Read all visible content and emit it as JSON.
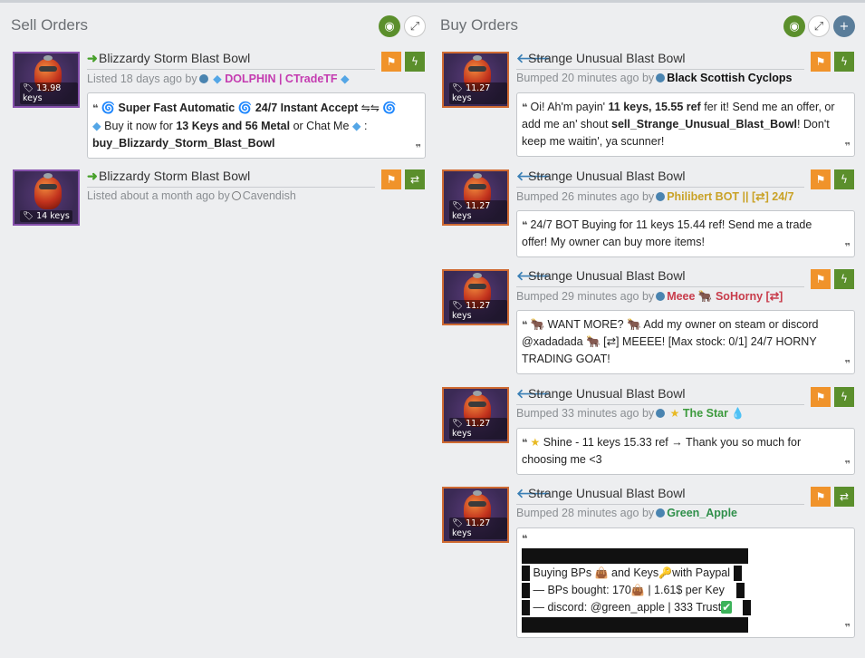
{
  "sell": {
    "title": "Sell Orders",
    "listings": [
      {
        "item": "Blizzardy Storm Blast Bowl",
        "price": "13.98 keys",
        "age": "Listed 18 days ago by",
        "user": "DOLPHIN | CTradeTF",
        "user_color": "#c43bb0",
        "action": "bolt",
        "message": {
          "p1": "Super Fast Automatic",
          "p2": "24/7 Instant Accept",
          "p3": "Buy it now for",
          "p4": "13 Keys and 56 Metal",
          "p5": "or Chat Me",
          "p6": ":",
          "p7": "buy_Blizzardy_Storm_Blast_Bowl"
        }
      },
      {
        "item": "Blizzardy Storm Blast Bowl",
        "price": "14 keys",
        "age": "Listed about a month ago by",
        "user": "Cavendish",
        "user_color": "#8a8e92",
        "action": "trade"
      }
    ]
  },
  "buy": {
    "title": "Buy Orders",
    "listings": [
      {
        "item": "Strange Unusual Blast Bowl",
        "price": "11.27 keys",
        "age": "Bumped 20 minutes ago by",
        "user": "Black Scottish Cyclops",
        "user_color": "#111111",
        "action": "bolt",
        "message": {
          "p1": "Oi! Ah'm payin'",
          "p2": "11 keys, 15.55 ref",
          "p3": "fer it! Send me an offer, or add me an' shout",
          "p4": "sell_Strange_Unusual_Blast_Bowl",
          "p5": "! Don't keep me waitin', ya scunner!"
        }
      },
      {
        "item": "Strange Unusual Blast Bowl",
        "price": "11.27 keys",
        "age": "Bumped 26 minutes ago by",
        "user": "Philibert BOT || [⇄] 24/7",
        "user_color": "#c9a227",
        "action": "bolt",
        "message": {
          "p1": "24/7 BOT Buying for 11 keys 15.44 ref! Send me a trade offer! My owner can buy more items!"
        }
      },
      {
        "item": "Strange Unusual Blast Bowl",
        "price": "11.27 keys",
        "age": "Bumped 29 minutes ago by",
        "user": "Meee 🐂 SoHorny [⇄]",
        "user_color": "#c83c4b",
        "action": "bolt",
        "message": {
          "p1": "🐂 WANT MORE? 🐂 Add my owner on steam or discord @xadadada 🐂 [⇄] MEEEE! [Max stock: 0/1] 24/7 HORNY TRADING GOAT!"
        }
      },
      {
        "item": "Strange Unusual Blast Bowl",
        "price": "11.27 keys",
        "age": "Bumped 33 minutes ago by",
        "user": "The Star",
        "user_color": "#3c9a3c",
        "action": "bolt",
        "message": {
          "p1": "Shine - 11 keys 15.33 ref → Thank you so much for choosing me <3"
        }
      },
      {
        "item": "Strange Unusual Blast Bowl",
        "price": "11.27 keys",
        "age": "Bumped 28 minutes ago by",
        "user": "Green_Apple",
        "user_color": "#2f8f4a",
        "action": "trade",
        "message": {
          "l1": "Buying BPs",
          "l1b": "and Keys",
          "l1c": "with Paypal",
          "l2": "— BPs bought: 170",
          "l2b": "| 1.61$ per Key",
          "l3": "— discord: @green_apple | 333 Trust"
        }
      }
    ]
  }
}
